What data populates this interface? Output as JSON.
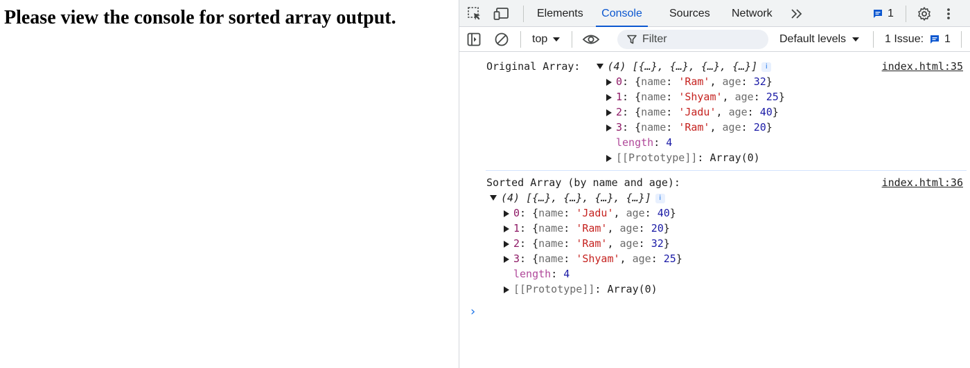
{
  "page": {
    "heading": "Please view the console for sorted array output."
  },
  "devtools": {
    "tabs": [
      "Elements",
      "Console",
      "Sources",
      "Network"
    ],
    "active_tab": "Console",
    "more_tabs_icon": "double-chevron-right-icon",
    "message_count": "1",
    "toolbar": {
      "context": "top",
      "filter_placeholder": "Filter",
      "levels": "Default levels",
      "issues_label": "1 Issue:",
      "issues_count": "1"
    },
    "colors": {
      "accent": "#0b57d0",
      "string": "#c5221f",
      "number": "#1a1aa6",
      "index": "#8e1a66",
      "length_key": "#b0499a"
    }
  },
  "console": {
    "messages": [
      {
        "label": "Original Array:",
        "preview": "(4) [{…}, {…}, {…}, {…}]",
        "source": "index.html:35",
        "items": [
          {
            "index": "0",
            "name": "'Ram'",
            "age": "32"
          },
          {
            "index": "1",
            "name": "'Shyam'",
            "age": "25"
          },
          {
            "index": "2",
            "name": "'Jadu'",
            "age": "40"
          },
          {
            "index": "3",
            "name": "'Ram'",
            "age": "20"
          }
        ],
        "length_label": "length",
        "length_value": "4",
        "prototype_label": "[[Prototype]]",
        "prototype_value": "Array(0)"
      },
      {
        "label": "Sorted Array (by name and age):",
        "preview": "(4) [{…}, {…}, {…}, {…}]",
        "source": "index.html:36",
        "items": [
          {
            "index": "0",
            "name": "'Jadu'",
            "age": "40"
          },
          {
            "index": "1",
            "name": "'Ram'",
            "age": "20"
          },
          {
            "index": "2",
            "name": "'Ram'",
            "age": "32"
          },
          {
            "index": "3",
            "name": "'Shyam'",
            "age": "25"
          }
        ],
        "length_label": "length",
        "length_value": "4",
        "prototype_label": "[[Prototype]]",
        "prototype_value": "Array(0)"
      }
    ],
    "key_name": "name",
    "key_age": "age",
    "info_badge": "i",
    "prompt": "›"
  }
}
